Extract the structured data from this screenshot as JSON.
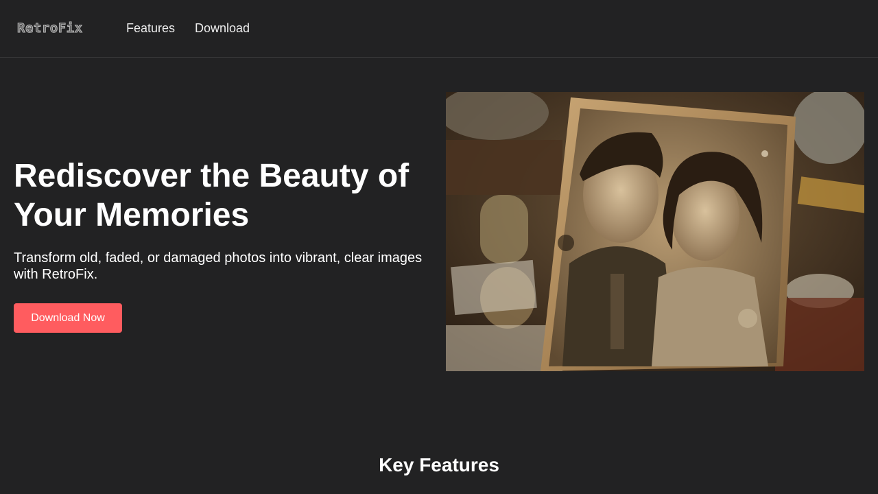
{
  "nav": {
    "logo": "RetroFix",
    "links": [
      {
        "label": "Features"
      },
      {
        "label": "Download"
      }
    ]
  },
  "hero": {
    "title": "Rediscover the Beauty of Your Memories",
    "subtitle": "Transform old, faded, or damaged photos into vibrant, clear images with RetroFix.",
    "cta_label": "Download Now",
    "image_alt": "Vintage sepia photo of a couple"
  },
  "features": {
    "title": "Key Features"
  },
  "colors": {
    "background": "#222223",
    "accent": "#ff5c5f",
    "text": "#ffffff"
  }
}
